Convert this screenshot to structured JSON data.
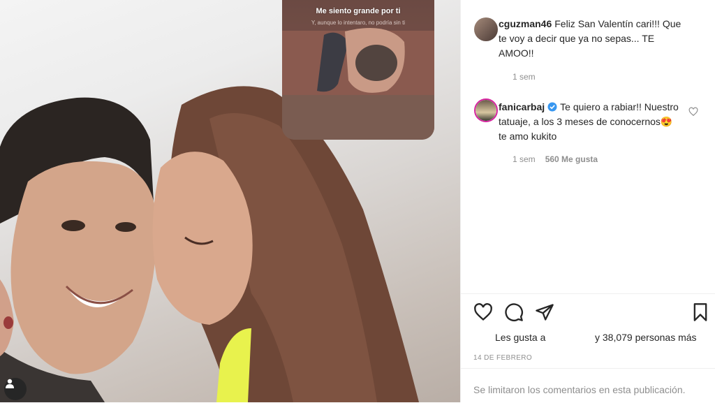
{
  "story": {
    "title": "Me siento grande por ti",
    "subtitle": "Y, aunque lo intentaro, no podría sin ti"
  },
  "comments": [
    {
      "username": "cguzman46",
      "text": "Feliz San Valentín cari!!! Que te voy a decir que ya no sepas... TE AMOO!!",
      "time": "1 sem",
      "verified": false
    },
    {
      "username": "fanicarbaj",
      "text": "Te quiero a rabiar!! Nuestro tatuaje, a los 3 meses de conocernos😍 te amo kukito",
      "time": "1 sem",
      "likes": "560 Me gusta",
      "verified": true
    }
  ],
  "likes": {
    "prefix": "Les gusta a",
    "suffix": "y 38,079 personas más"
  },
  "date": "14 DE FEBRERO",
  "comments_closed": "Se limitaron los comentarios en esta publicación.",
  "colors": {
    "verified": "#3897f0",
    "muted": "#8e8e8e",
    "text": "#262626"
  },
  "icons": [
    "heart-icon",
    "comment-icon",
    "share-icon",
    "bookmark-icon",
    "user-icon",
    "verified-icon"
  ]
}
